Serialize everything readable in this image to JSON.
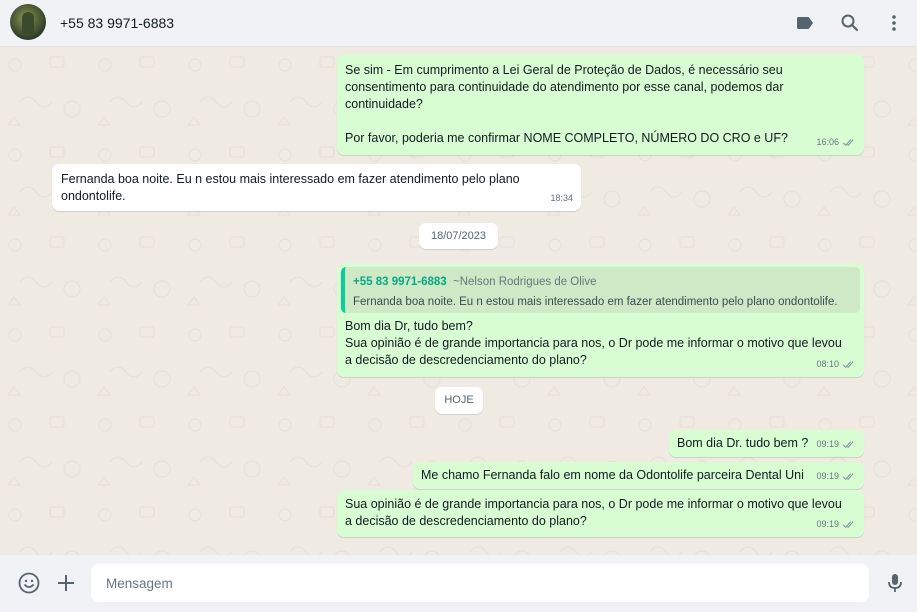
{
  "header": {
    "contact_name": "+55 83 9971-6883",
    "icons": [
      "label-icon",
      "search-icon",
      "menu-icon"
    ]
  },
  "messages": [
    {
      "direction": "out",
      "lines": [
        "Se sim - Em cumprimento a Lei Geral de Proteção de Dados, é necessário seu",
        "consentimento para continuidade do atendimento por esse canal, podemos dar",
        "continuidade?",
        "",
        "Por favor, poderia me confirmar NOME COMPLETO, NÚMERO DO CRO e UF?"
      ],
      "time": "16:06",
      "status": "read"
    },
    {
      "direction": "in",
      "lines": [
        "Fernanda boa noite. Eu n estou  mais interessado em fazer atendimento pelo plano",
        "ondontolife."
      ],
      "time": "18:34"
    },
    {
      "direction": "out",
      "quoted": {
        "from": "+55 83 9971-6883",
        "alias": "~Nelson Rodrigues de Olive",
        "text": "Fernanda boa noite. Eu n estou  mais interessado em fazer atendimento pelo plano ondontolife."
      },
      "lines": [
        "Bom dia Dr, tudo bem?",
        "Sua opinião é de grande importancia para nos, o Dr pode me informar o motivo que levou",
        "a decisão de descredenciamento do plano?"
      ],
      "time": "08:10",
      "status": "read"
    },
    {
      "direction": "out",
      "lines": [
        "Bom dia Dr. tudo bem ?"
      ],
      "time": "09:19",
      "status": "read"
    },
    {
      "direction": "out",
      "lines": [
        "Me chamo Fernanda falo em nome da Odontolife parceira Dental Uni"
      ],
      "time": "09:19",
      "status": "read"
    },
    {
      "direction": "out",
      "lines": [
        "Sua opinião é de grande importancia para nos, o Dr pode me informar o motivo que levou",
        "a decisão de descredenciamento do plano?"
      ],
      "time": "09:19",
      "status": "read"
    }
  ],
  "date_chips": [
    "18/07/2023",
    "HOJE"
  ],
  "footer": {
    "placeholder": "Mensagem",
    "icons": [
      "emoji-icon",
      "attach-icon",
      "microphone-icon"
    ]
  },
  "colors": {
    "outgoing_bubble": "#d9fdd3",
    "incoming_bubble": "#ffffff",
    "chat_background": "#efeae2",
    "quote_accent": "#06cf9c",
    "read_ticks": "#8696a0"
  }
}
